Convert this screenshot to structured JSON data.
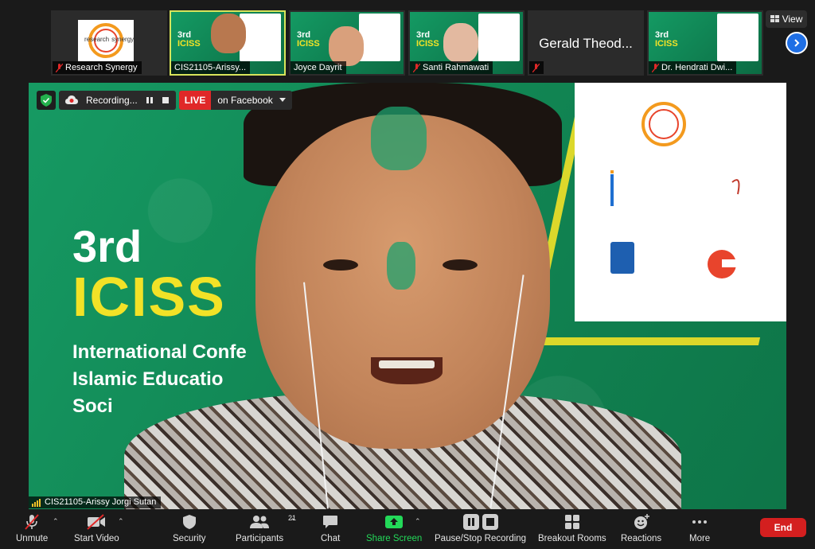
{
  "thumbnails": [
    {
      "name": "Research Synergy",
      "muted": true,
      "type": "logo"
    },
    {
      "name": "CIS21105-Arissy...",
      "muted": false,
      "type": "video",
      "active": true
    },
    {
      "name": "Joyce Dayrit",
      "muted": false,
      "type": "video"
    },
    {
      "name": "Santi Rahmawati",
      "muted": true,
      "type": "video"
    },
    {
      "name": "Gerald Theod...",
      "muted": true,
      "type": "name-only"
    },
    {
      "name": "Dr. Hendrati Dwi...",
      "muted": true,
      "type": "video"
    }
  ],
  "logo": {
    "text_left": "research",
    "text_right": "synergy"
  },
  "thumb_title": {
    "n3": "3rd",
    "iciss": "ICISS"
  },
  "view": {
    "label": "View"
  },
  "recording": {
    "label": "Recording..."
  },
  "live": {
    "tag": "LIVE",
    "platform": "on Facebook"
  },
  "main": {
    "speaker_name": "CIS21105-Arissy Jorgi Sutan",
    "event_number": "3rd",
    "event_name": "ICISS",
    "event_line1": "International Confe",
    "event_line2": "Islamic Educatio",
    "event_line3": "Soci"
  },
  "toolbar": {
    "unmute": "Unmute",
    "start_video": "Start Video",
    "security": "Security",
    "participants": "Participants",
    "participants_count": "21",
    "chat": "Chat",
    "share_screen": "Share Screen",
    "pause_stop_recording": "Pause/Stop Recording",
    "breakout_rooms": "Breakout Rooms",
    "reactions": "Reactions",
    "more": "More",
    "end": "End"
  },
  "colors": {
    "accent_yellow": "#f2e227",
    "green": "#14905c",
    "share_green": "#23d959",
    "end_red": "#d41f1f",
    "next_blue": "#1f6fe5"
  }
}
